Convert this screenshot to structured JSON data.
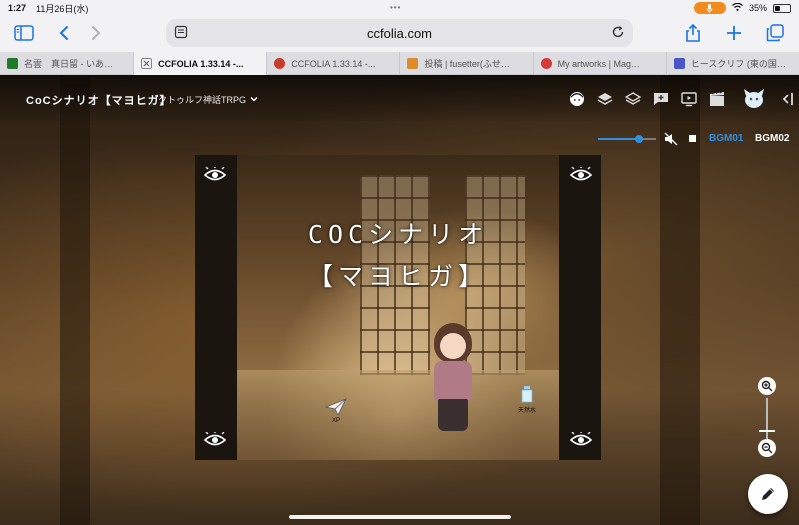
{
  "status_bar": {
    "time": "1:27",
    "date": "11月26日(水)",
    "battery_percent": "35%",
    "battery_level": 0.35
  },
  "browser": {
    "url": "ccfolia.com",
    "tabs": [
      {
        "label": "名雲　真日留 - いあ…",
        "favicon_color": "#1f7a2a",
        "active": false
      },
      {
        "label": "CCFOLIA 1.33.14 -...",
        "favicon_color": "#ffffff",
        "active": true
      },
      {
        "label": "CCFOLIA 1.33.14 -...",
        "favicon_color": "#cc3a2a",
        "active": false
      },
      {
        "label": "投稿 | fusetter(ふせ…",
        "favicon_color": "#e08a2a",
        "active": false
      },
      {
        "label": "My artworks | Mag…",
        "favicon_color": "#d43a3a",
        "active": false
      },
      {
        "label": "ヒースクリフ (東の国…",
        "favicon_color": "#4a55c8",
        "active": false
      }
    ]
  },
  "room": {
    "title": "CoCシナリオ【マヨヒガ】",
    "subtitle": "クトゥルフ神話TRPG"
  },
  "header_icons": [
    "character-icon",
    "layers-icon",
    "layers-outline-icon",
    "chat-add-icon",
    "screen-icon",
    "scene-icon",
    "avatar-icon",
    "collapse-panel-icon"
  ],
  "bgm": {
    "volume": 0.7,
    "bgm01_label": "BGM01",
    "bgm02_label": "BGM02",
    "active_color": "#2e8fe0"
  },
  "stage": {
    "title_line1": "COCシナリオ",
    "title_line2": "【マヨヒガ】",
    "token_xp_label": "XP",
    "token_water_label": "天然水"
  },
  "colors": {
    "accent": "#2e8fe0",
    "browser_chrome": "#f2f2f4",
    "mic_pill": "#f28b1e"
  }
}
